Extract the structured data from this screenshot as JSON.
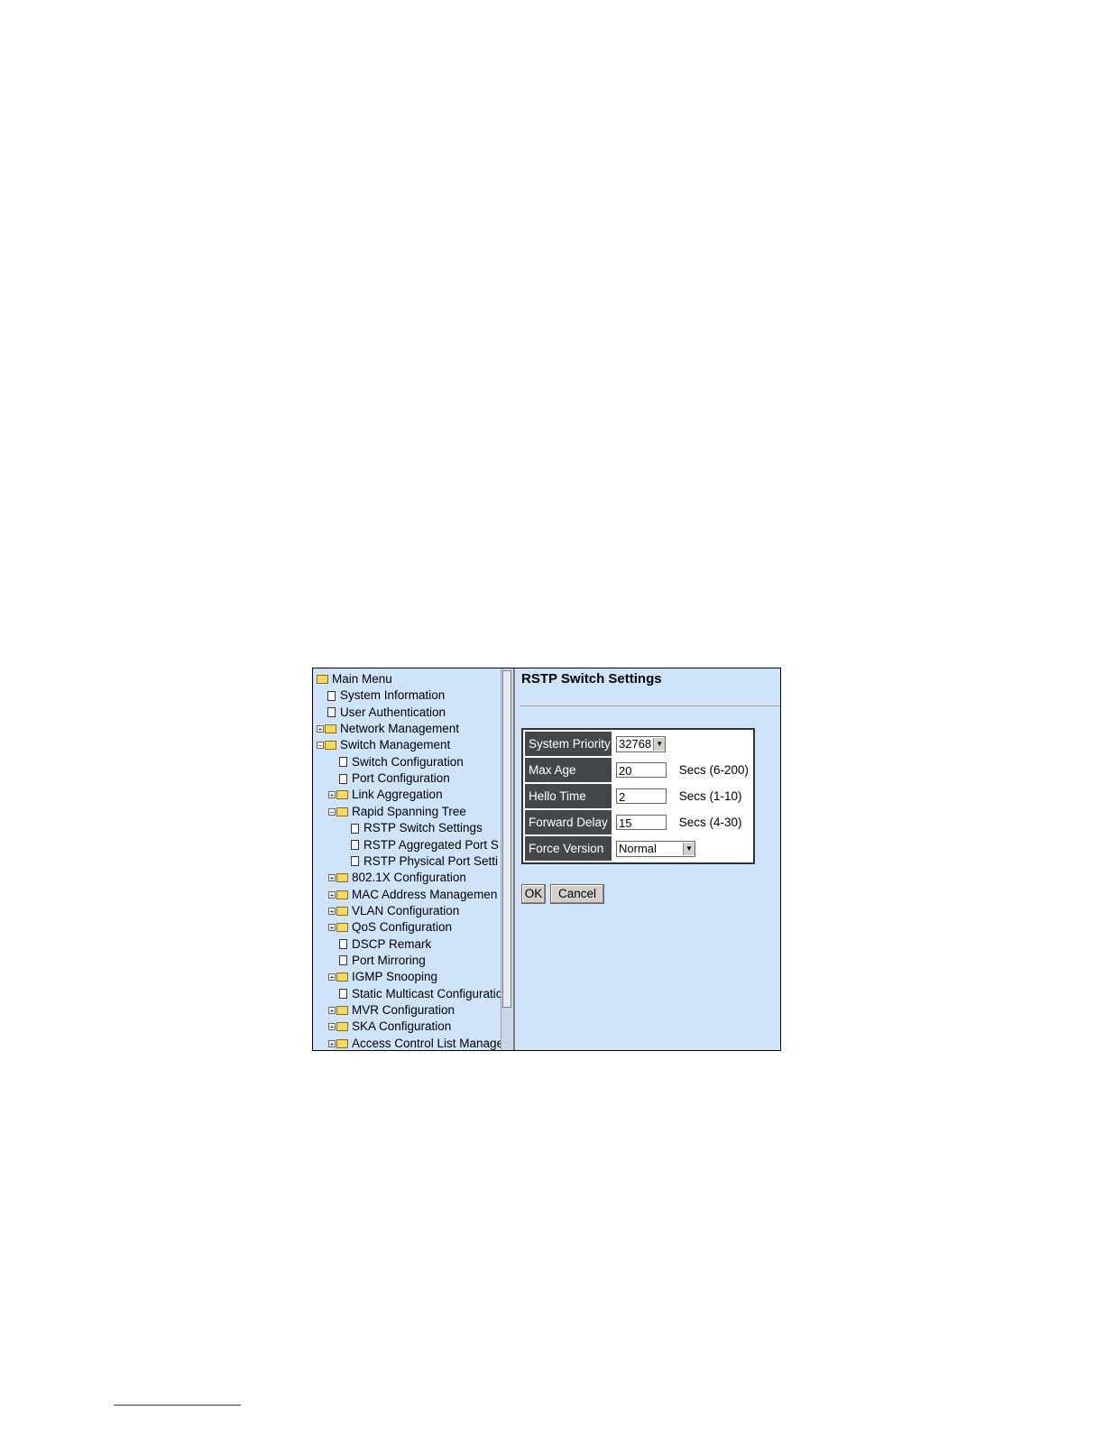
{
  "tree": {
    "root": "Main Menu",
    "items": [
      {
        "label": "System Information",
        "type": "doc",
        "level": 1
      },
      {
        "label": "User Authentication",
        "type": "doc",
        "level": 1
      },
      {
        "label": "Network Management",
        "type": "folder",
        "level": 1,
        "expander": "+"
      },
      {
        "label": "Switch Management",
        "type": "folder-open",
        "level": 1,
        "expander": "-"
      },
      {
        "label": "Switch Configuration",
        "type": "doc",
        "level": 2
      },
      {
        "label": "Port Configuration",
        "type": "doc",
        "level": 2
      },
      {
        "label": "Link Aggregation",
        "type": "folder",
        "level": 2,
        "expander": "+"
      },
      {
        "label": "Rapid Spanning Tree",
        "type": "folder-open",
        "level": 2,
        "expander": "-"
      },
      {
        "label": "RSTP Switch Settings",
        "type": "doc",
        "level": 3
      },
      {
        "label": "RSTP Aggregated Port S",
        "type": "doc",
        "level": 3
      },
      {
        "label": "RSTP Physical Port Setti",
        "type": "doc",
        "level": 3
      },
      {
        "label": "802.1X Configuration",
        "type": "folder",
        "level": 2,
        "expander": "+"
      },
      {
        "label": "MAC Address Managemen",
        "type": "folder",
        "level": 2,
        "expander": "+"
      },
      {
        "label": "VLAN Configuration",
        "type": "folder",
        "level": 2,
        "expander": "+"
      },
      {
        "label": "QoS Configuration",
        "type": "folder",
        "level": 2,
        "expander": "+"
      },
      {
        "label": "DSCP Remark",
        "type": "doc",
        "level": 2
      },
      {
        "label": "Port Mirroring",
        "type": "doc",
        "level": 2
      },
      {
        "label": "IGMP Snooping",
        "type": "folder",
        "level": 2,
        "expander": "+"
      },
      {
        "label": "Static Multicast Configuratio",
        "type": "doc",
        "level": 2
      },
      {
        "label": "MVR Configuration",
        "type": "folder",
        "level": 2,
        "expander": "+"
      },
      {
        "label": "SKA Configuration",
        "type": "folder",
        "level": 2,
        "expander": "+"
      },
      {
        "label": "Access Control List Manage",
        "type": "folder",
        "level": 2,
        "expander": "+"
      }
    ]
  },
  "page": {
    "title": "RSTP Switch Settings",
    "fields": {
      "system_priority": {
        "label": "System Priority",
        "value": "32768"
      },
      "max_age": {
        "label": "Max Age",
        "value": "20",
        "unit": "Secs (6-200)"
      },
      "hello_time": {
        "label": "Hello Time",
        "value": "2",
        "unit": "Secs (1-10)"
      },
      "forward_delay": {
        "label": "Forward Delay",
        "value": "15",
        "unit": "Secs (4-30)"
      },
      "force_version": {
        "label": "Force Version",
        "value": "Normal"
      }
    },
    "ok_label": "OK",
    "cancel_label": "Cancel"
  },
  "colors": {
    "panel_bg": "#cfe4fb",
    "label_bg": "#44474b"
  }
}
